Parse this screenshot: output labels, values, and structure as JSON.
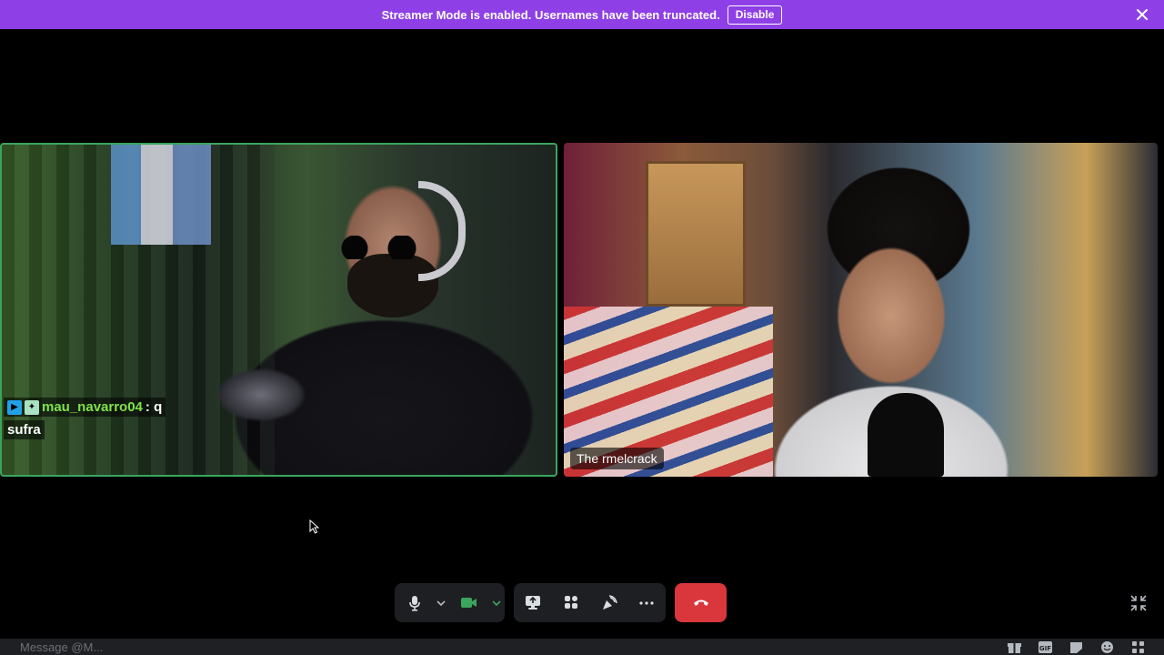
{
  "banner": {
    "text": "Streamer Mode is enabled. Usernames have been truncated.",
    "disable_label": "Disable",
    "color": "#8f3fe6"
  },
  "tiles": [
    {
      "speaking": true,
      "speaking_color": "#3ba55d",
      "chat_overlay": {
        "username": "mau_navarro04",
        "separator": " : q",
        "message": "sufra"
      }
    },
    {
      "speaking": false,
      "name_label": "The rmelcrack"
    }
  ],
  "controls": {
    "icons": [
      "microphone-icon",
      "chevron-down-icon",
      "camera-icon",
      "chevron-down-icon",
      "screen-share-icon",
      "activities-icon",
      "soundboard-icon",
      "more-icon",
      "hang-up-icon"
    ],
    "camera_on_color": "#3ba55d",
    "hang_up_color": "#da373c"
  },
  "message_bar": {
    "placeholder": "Message @M...",
    "icons": [
      "gift-icon",
      "gif-icon",
      "sticker-icon",
      "emoji-icon",
      "apps-icon"
    ]
  }
}
